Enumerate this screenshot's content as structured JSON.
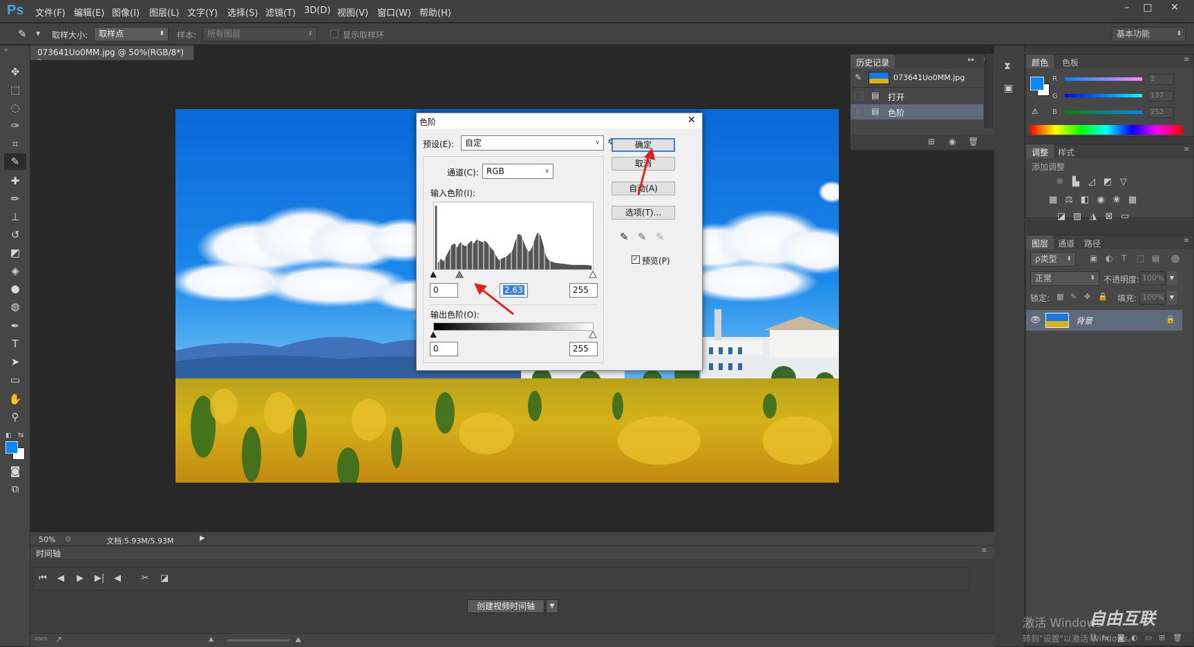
{
  "app": {
    "logo": "Ps"
  },
  "menu": [
    "文件(F)",
    "编辑(E)",
    "图像(I)",
    "图层(L)",
    "文字(Y)",
    "选择(S)",
    "滤镜(T)",
    "3D(D)",
    "视图(V)",
    "窗口(W)",
    "帮助(H)"
  ],
  "options": {
    "sample_size_label": "取样大小:",
    "sample_size_value": "取样点",
    "sample_label": "样本:",
    "sample_value": "所有图层",
    "show_ring_label": "显示取样环",
    "workspace": "基本功能"
  },
  "document": {
    "tab_title": "073641Uo0MM.jpg @ 50%(RGB/8*) *",
    "close": "×"
  },
  "status": {
    "zoom": "50%",
    "doc_size": "文档:5.93M/5.93M"
  },
  "timeline": {
    "title": "时间轴",
    "create_button": "创建视频时间轴"
  },
  "history": {
    "title": "历史记录",
    "snapshot": "073641Uo0MM.jpg",
    "items": [
      "打开",
      "色阶"
    ]
  },
  "color_panel": {
    "tabs": [
      "颜色",
      "色板"
    ],
    "channels": [
      {
        "label": "R",
        "value": "2"
      },
      {
        "label": "G",
        "value": "137"
      },
      {
        "label": "B",
        "value": "252"
      }
    ],
    "foreground": "#0289fc"
  },
  "adjust_panel": {
    "tabs": [
      "调整",
      "样式"
    ],
    "subtitle": "添加调整"
  },
  "layers_panel": {
    "tabs": [
      "图层",
      "通道",
      "路径"
    ],
    "filter": "ρ类型",
    "blend_mode": "正常",
    "opacity_label": "不透明度:",
    "opacity_value": "100%",
    "lock_label": "锁定:",
    "fill_label": "填充:",
    "fill_value": "100%",
    "layer_name": "背景"
  },
  "levels_dialog": {
    "title": "色阶",
    "preset_label": "预设(E):",
    "preset_value": "自定",
    "channel_label": "通道(C):",
    "channel_value": "RGB",
    "input_label": "输入色阶(I):",
    "input_black": "0",
    "input_gamma": "2.63",
    "input_white": "255",
    "output_label": "输出色阶(O):",
    "output_black": "0",
    "output_white": "255",
    "ok": "确定",
    "cancel": "取消",
    "auto": "自动(A)",
    "options": "选项(T)...",
    "preview": "预览(P)"
  },
  "watermark": {
    "line1": "激活 Windows",
    "line2": "转到\"设置\"以激活 Windows。",
    "brand": "自由互联"
  }
}
